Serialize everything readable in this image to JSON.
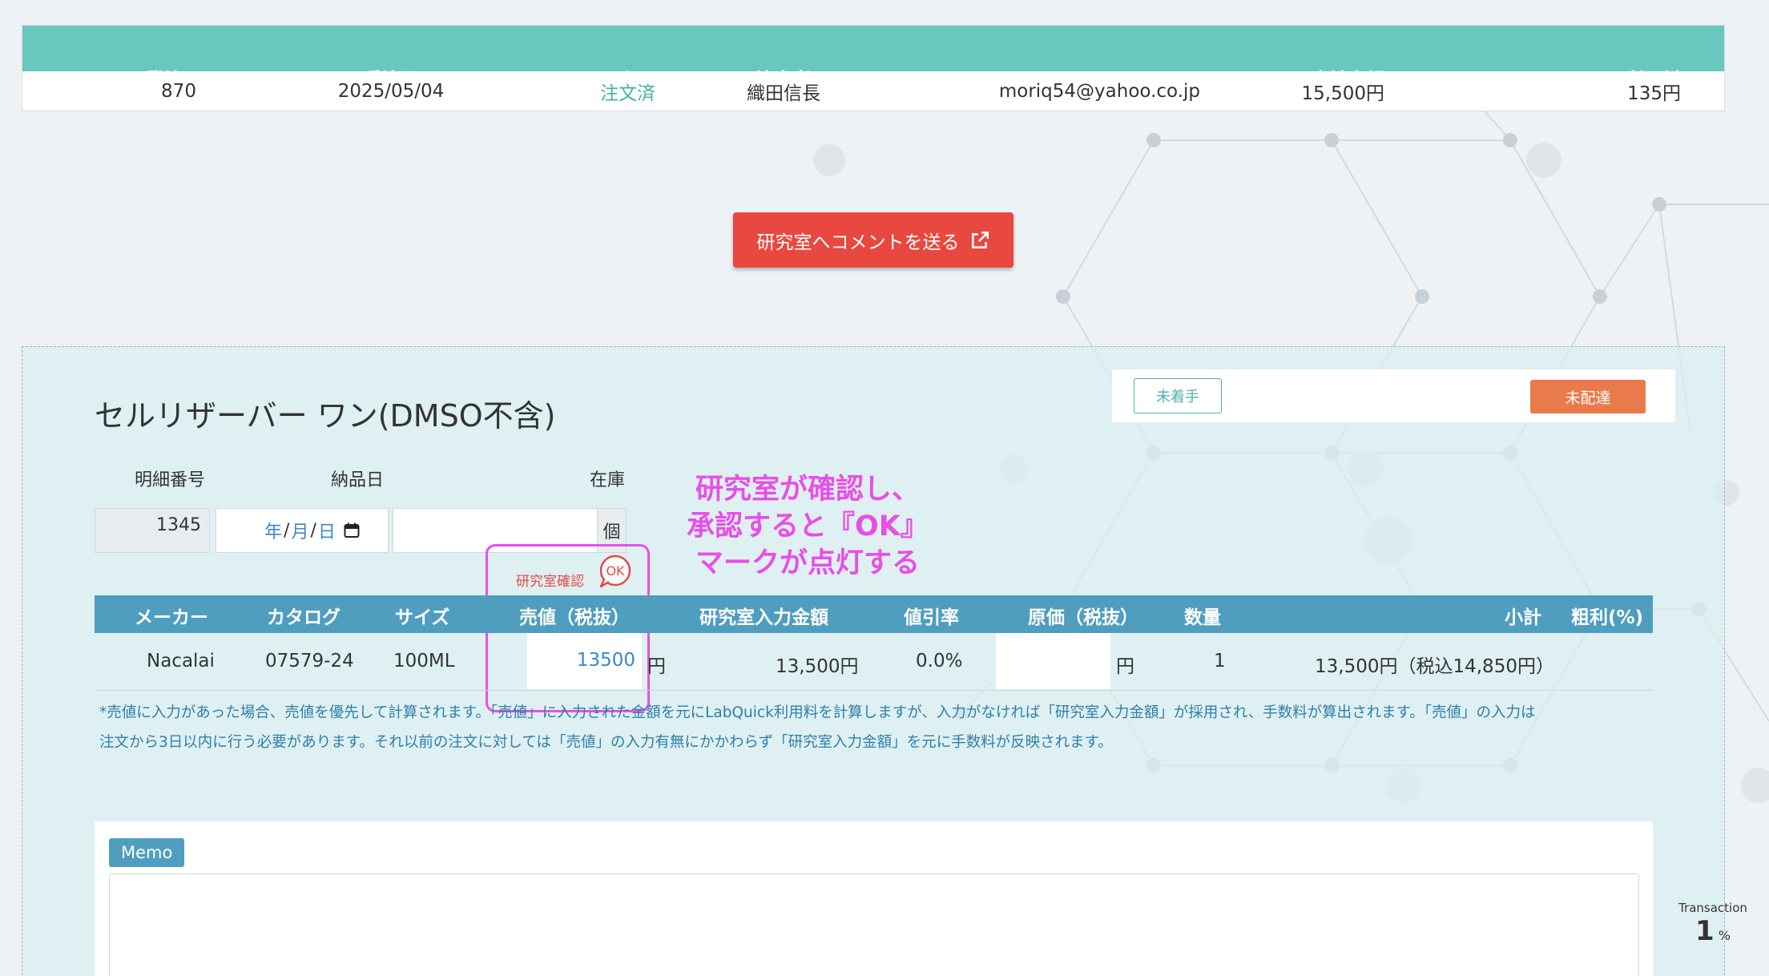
{
  "order": {
    "headers": {
      "no": "発注No",
      "received": "受注日",
      "status": "ステータス",
      "orderer": "注文者",
      "mail": "メール",
      "total": "合計金額",
      "fee": "LabQuick利用料"
    },
    "row": {
      "no": "870",
      "received": "2025/05/04",
      "status": "注文済",
      "orderer": "織田信長",
      "mail": "moriq54@yahoo.co.jp",
      "total": "15,500円",
      "fee": "135円"
    }
  },
  "comment_button": {
    "label": "研究室へコメントを送る",
    "icon": "external-link-icon"
  },
  "item": {
    "title": "セルリザーバー ワン(DMSO不含)",
    "status_buttons": {
      "unstarted": "未着手",
      "undelivered": "未配達"
    },
    "labels": {
      "detail_no": "明細番号",
      "delivery_date": "納品日",
      "stock": "在庫"
    },
    "fields": {
      "detail_no": "1345",
      "date_placeholder_year": "年",
      "date_placeholder_month": "月",
      "date_placeholder_day": "日",
      "stock_value": "",
      "stock_unit": "個"
    },
    "lab_confirm_label": "研究室確認",
    "ok_mark": "OK",
    "table": {
      "headers": {
        "maker": "メーカー",
        "catalog": "カタログ",
        "size": "サイズ",
        "sale_price": "売値（税抜）",
        "lab_amount": "研究室入力金額",
        "discount": "値引率",
        "cost": "原価（税抜）",
        "qty": "数量",
        "subtotal": "小計",
        "margin": "粗利(%)"
      },
      "row": {
        "maker": "Nacalai",
        "catalog": "07579-24",
        "size": "100ML",
        "sale_price": "13500",
        "sale_unit": "円",
        "lab_amount": "13,500円",
        "discount": "0.0%",
        "cost": "",
        "cost_unit": "円",
        "qty": "1",
        "subtotal": "13,500円（税込14,850円）",
        "margin": ""
      }
    },
    "note_line1": "*売値に入力があった場合、売値を優先して計算されます。「売値」に入力された金額を元にLabQuick利用料を計算しますが、入力がなければ「研究室入力金額」が採用され、手数料が算出されます。「売値」の入力は",
    "note_line2": "注文から3日以内に行う必要があります。それ以前の注文に対しては「売値」の入力有無にかかわらず「研究室入力金額」を元に手数料が反映されます。",
    "memo_label": "Memo",
    "memo_value": ""
  },
  "annotation": {
    "line1": "研究室が確認し、",
    "line2": "承認すると『OK』",
    "line3": "マークが点灯する",
    "color": "#e84fe6"
  },
  "transaction": {
    "label": "Transaction",
    "value": "1",
    "unit": "%"
  },
  "colors": {
    "order_header": "#68c8be",
    "comment_button": "#e8483f",
    "table_header": "#4f9ebf",
    "undelivered": "#e97a4a",
    "status_ordered": "#3fb39a"
  }
}
